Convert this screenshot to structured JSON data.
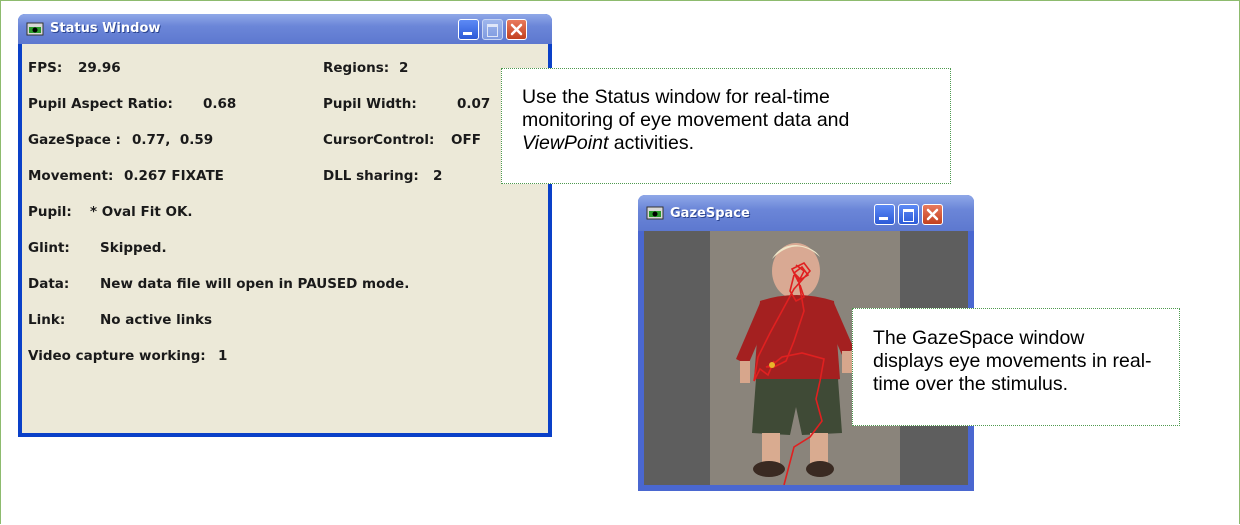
{
  "status_window": {
    "title": "Status Window",
    "fps_label": "FPS:",
    "fps_value": "29.96",
    "regions_label": "Regions:",
    "regions_value": "2",
    "pupil_aspect_label": "Pupil Aspect Ratio:",
    "pupil_aspect_value": "0.68",
    "pupil_width_label": "Pupil Width:",
    "pupil_width_value": "0.07",
    "gazespace_label": "GazeSpace :",
    "gazespace_value": "0.77,  0.59",
    "cursor_label": "CursorControl:",
    "cursor_value": "OFF",
    "movement_label": "Movement:",
    "movement_value": "0.267 FIXATE",
    "dll_label": "DLL sharing:",
    "dll_value": "2",
    "pupil_label": "Pupil:",
    "pupil_value": "* Oval Fit OK.",
    "glint_label": "Glint:",
    "glint_value": "Skipped.",
    "data_label": "Data:",
    "data_value": "New data file will open in PAUSED mode.",
    "link_label": "Link:",
    "link_value": "No active links",
    "video_label": "Video capture working:",
    "video_value": "1"
  },
  "gaze_window": {
    "title": "GazeSpace"
  },
  "callout_status": {
    "line1": "Use the Status window for real-time",
    "line2": "monitoring of eye movement data and",
    "line3_italic": "ViewPoint",
    "line3_rest": " activities."
  },
  "callout_gaze": {
    "line1": "The GazeSpace window",
    "line2": "displays eye movements in real-",
    "line3": "time over the stimulus."
  },
  "colors": {
    "window_frame": "#0a40c8",
    "client_bg": "#ece9d8",
    "callout_border": "#4f9a4f",
    "gaze_trace": "#e02020"
  }
}
